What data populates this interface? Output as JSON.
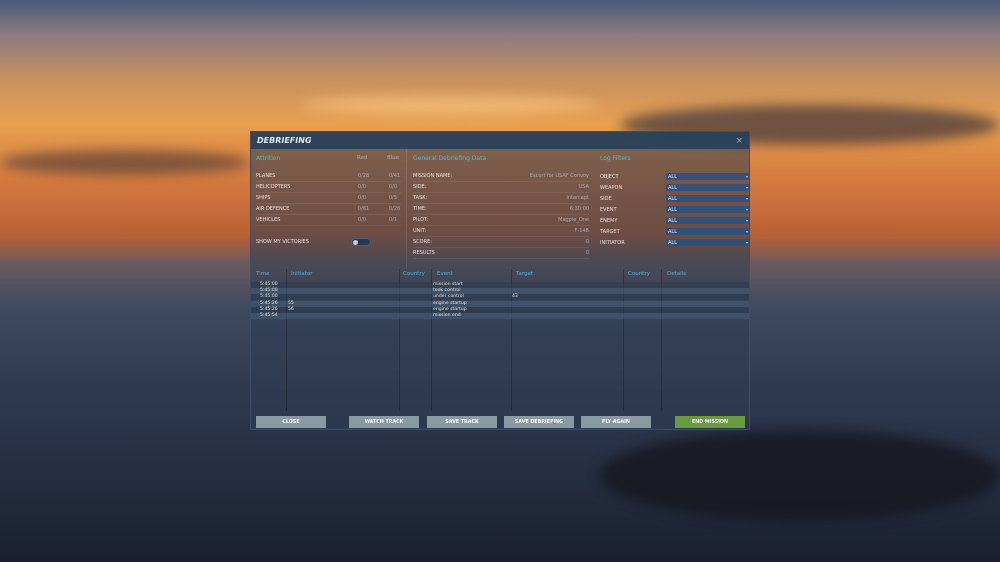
{
  "dialog": {
    "title": "DEBRIEFING",
    "close": "×"
  },
  "attrition": {
    "header": "Attrition",
    "col_red": "Red",
    "col_blue": "Blue",
    "rows": [
      {
        "label": "PLANES",
        "red": "0/28",
        "blue": "0/41"
      },
      {
        "label": "HELICOPTERS",
        "red": "0/0",
        "blue": "0/0"
      },
      {
        "label": "SHIPS",
        "red": "0/0",
        "blue": "0/5"
      },
      {
        "label": "AIR DEFENCE",
        "red": "0/61",
        "blue": "0/28"
      },
      {
        "label": "VEHICLES",
        "red": "0/0",
        "blue": "0/1"
      }
    ],
    "victories_label": "SHOW MY VICTORIES",
    "victories_on": false
  },
  "general": {
    "header": "General Debriefing Data",
    "rows": [
      {
        "label": "MISSION NAME:",
        "value": "Escort  for USAF Convoy"
      },
      {
        "label": "SIDE:",
        "value": "USA"
      },
      {
        "label": "TASK:",
        "value": "Intercept"
      },
      {
        "label": "TIME:",
        "value": "6:30:00"
      },
      {
        "label": "PILOT:",
        "value": "Magpie_One"
      },
      {
        "label": "UNIT:",
        "value": "F-14B"
      },
      {
        "label": "SCORE:",
        "value": "0"
      },
      {
        "label": "RESULTS",
        "value": "0"
      }
    ]
  },
  "filters": {
    "header": "Log Filters",
    "rows": [
      {
        "label": "OBJECT",
        "value": "ALL"
      },
      {
        "label": "WEAPON",
        "value": "ALL"
      },
      {
        "label": "SIDE",
        "value": "ALL"
      },
      {
        "label": "EVENT",
        "value": "ALL"
      },
      {
        "label": "ENEMY",
        "value": "ALL"
      },
      {
        "label": "TARGET",
        "value": "ALL"
      },
      {
        "label": "INITIATOR",
        "value": "ALL"
      }
    ]
  },
  "log": {
    "headers": {
      "time": "Time",
      "initiator": "Initiator",
      "country": "Country",
      "event": "Event",
      "target": "Target",
      "country2": "Country",
      "details": "Details"
    },
    "rows": [
      {
        "time": "5:45:00",
        "initiator": "",
        "event": "mission start",
        "target": ""
      },
      {
        "time": "5:45:00",
        "initiator": "",
        "event": "took control",
        "target": ""
      },
      {
        "time": "5:45:00",
        "initiator": "",
        "event": "under control",
        "target": "43"
      },
      {
        "time": "5:45:26",
        "initiator": "55",
        "event": "engine startup",
        "target": ""
      },
      {
        "time": "5:45:26",
        "initiator": "56",
        "event": "engine startup",
        "target": ""
      },
      {
        "time": "5:45:54",
        "initiator": "",
        "event": "mission end",
        "target": ""
      }
    ]
  },
  "buttons": {
    "close": "CLOSE",
    "watch": "WATCH TRACK",
    "save_track": "SAVE TRACK",
    "save_debrief": "SAVE DEBRIEFING",
    "fly_again": "FLY AGAIN",
    "end": "END MISSION"
  }
}
